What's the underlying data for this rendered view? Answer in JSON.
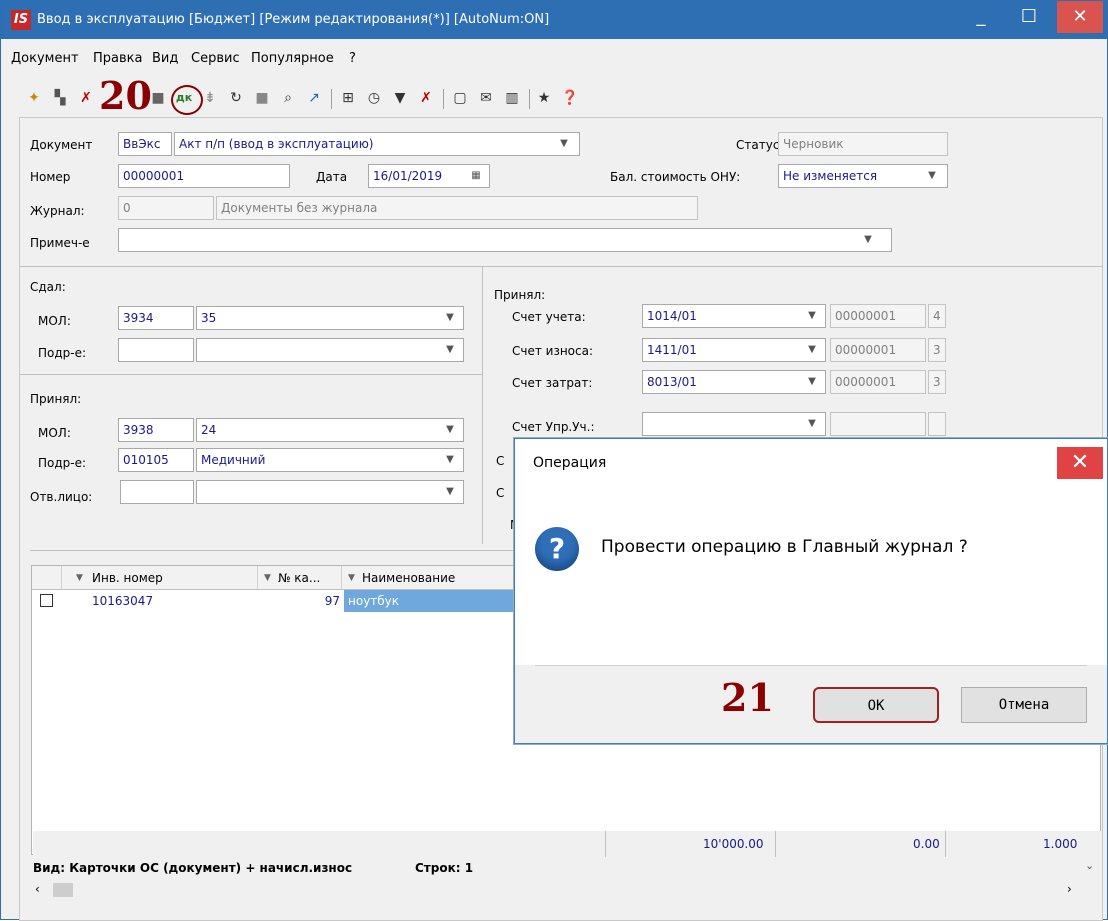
{
  "window": {
    "logo": "IS",
    "title": "Ввод в эксплуатацию [Бюджет] [Режим редактирования(*)] [AutoNum:ON]",
    "minimize": "_",
    "maximize": "☐",
    "close": "✕"
  },
  "menu": [
    "Документ",
    "Правка",
    "Вид",
    "Сервис",
    "Популярное",
    "?"
  ],
  "annotations": {
    "step20": "20",
    "step21": "21"
  },
  "form": {
    "doc_label": "Документ",
    "doc_code": "ВвЭкс",
    "doc_name": "Акт п/п (ввод в эксплуатацию)",
    "status_label": "Статус",
    "status_value": "Черновик",
    "number_label": "Номер",
    "number_value": "00000001",
    "date_label": "Дата",
    "date_value": "16/01/2019",
    "onu_label": "Бал. стоимость ОНУ:",
    "onu_value": "Не изменяется",
    "journal_label": "Журнал:",
    "journal_code": "0",
    "journal_name": "Документы без журнала",
    "note_label": "Примеч-е",
    "note_value": ""
  },
  "gave": {
    "section": "Сдал:",
    "mol_label": "МОЛ:",
    "mol_code": "3934",
    "mol_name": "35",
    "dept_label": "Подр-е:",
    "dept_code": "",
    "dept_name": ""
  },
  "received": {
    "section": "Принял:",
    "mol_label": "МОЛ:",
    "mol_code": "3938",
    "mol_name": "24",
    "dept_label": "Подр-е:",
    "dept_code": "010105",
    "dept_name": "Медичний",
    "resp_label": "Отв.лицо:",
    "resp_code": "",
    "resp_name": ""
  },
  "accounts": {
    "section": "Принял:",
    "rows": [
      {
        "label": "Счет учета:",
        "account": "1014/01",
        "code": "00000001",
        "n": "4"
      },
      {
        "label": "Счет износа:",
        "account": "1411/01",
        "code": "00000001",
        "n": "3"
      },
      {
        "label": "Счет затрат:",
        "account": "8013/01",
        "code": "00000001",
        "n": "3"
      },
      {
        "label": "Счет Упр.Уч.:",
        "account": "",
        "code": "",
        "n": ""
      }
    ],
    "partial_labels": [
      "С",
      "С",
      "М"
    ]
  },
  "grid": {
    "columns": [
      "Инв. номер",
      "№ ка...",
      "Наименование"
    ],
    "rows": [
      {
        "inv": "10163047",
        "num": "97",
        "name": "ноутбук"
      }
    ],
    "totals": [
      "10'000.00",
      "0.00",
      "1.000"
    ],
    "footer_view": "Вид: Карточки ОС (документ) + начисл.износ",
    "footer_rows": "Строк: 1"
  },
  "dialog": {
    "title": "Операция",
    "close": "✕",
    "message": "Провести операцию в Главный журнал ?",
    "ok": "OK",
    "cancel": "Отмена"
  },
  "colors": {
    "title_bar": "#2e6fb4",
    "annotation": "#8b0000",
    "close_red": "#e04343",
    "field_text": "#1a1a8c"
  }
}
